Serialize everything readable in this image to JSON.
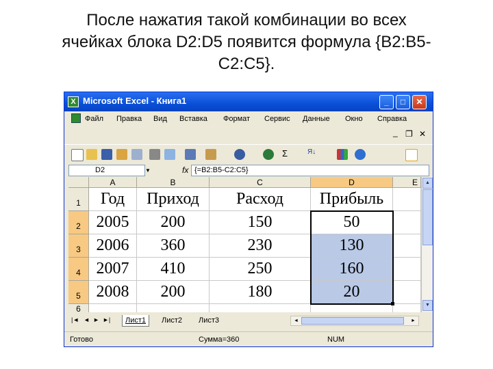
{
  "caption": {
    "line1": "После нажатия такой комбинации во всех",
    "line2": "ячейках блока D2:D5 появится формула {B2:B5-",
    "line3": "C2:C5}."
  },
  "window": {
    "title": "Microsoft Excel - Книга1",
    "controls": {
      "minimize": "_",
      "maximize": "□",
      "close": "✕"
    }
  },
  "menu": {
    "items": [
      "Файл",
      "Правка",
      "Вид",
      "Вставка",
      "Формат",
      "Сервис",
      "Данные",
      "Окно",
      "Справка"
    ],
    "doc_controls": {
      "minimize": "_",
      "restore": "❐",
      "close": "✕"
    }
  },
  "toolbar": {
    "sigma": "Σ",
    "sort_label": "Я↓",
    "icons": [
      "new-icon",
      "open-icon",
      "save-icon",
      "permission-icon",
      "email-icon",
      "print-icon",
      "preview-icon",
      "research-icon",
      "paste-icon",
      "undo-icon",
      "hyperlink-icon",
      "autosum-icon",
      "sort-ascending-icon",
      "chart-icon",
      "help-icon",
      "align-center-icon"
    ]
  },
  "formula_bar": {
    "name_box": "D2",
    "fx": "fx",
    "formula": "{=B2:B5-C2:C5}"
  },
  "sheet": {
    "columns": [
      "A",
      "B",
      "C",
      "D"
    ],
    "extra_column": "E",
    "rows": [
      "1",
      "2",
      "3",
      "4",
      "5",
      "6"
    ],
    "cells": [
      [
        "Год",
        "Приход",
        "Расход",
        "Прибыль"
      ],
      [
        "2005",
        "200",
        "150",
        "50"
      ],
      [
        "2006",
        "360",
        "230",
        "130"
      ],
      [
        "2007",
        "410",
        "250",
        "160"
      ],
      [
        "2008",
        "200",
        "180",
        "20"
      ]
    ],
    "selected_range": "D2:D5"
  },
  "tabs": {
    "nav": [
      "|◄",
      "◄",
      "►",
      "►|"
    ],
    "sheets": [
      "Лист1",
      "Лист2",
      "Лист3"
    ],
    "active": "Лист1"
  },
  "status": {
    "ready": "Готово",
    "sum": "Сумма=360",
    "num": "NUM"
  },
  "colors": {
    "titlebar": "#0a4fd8",
    "selection": "#b9c9e6",
    "header_highlight": "#f7c982",
    "chrome": "#ece9d8"
  }
}
